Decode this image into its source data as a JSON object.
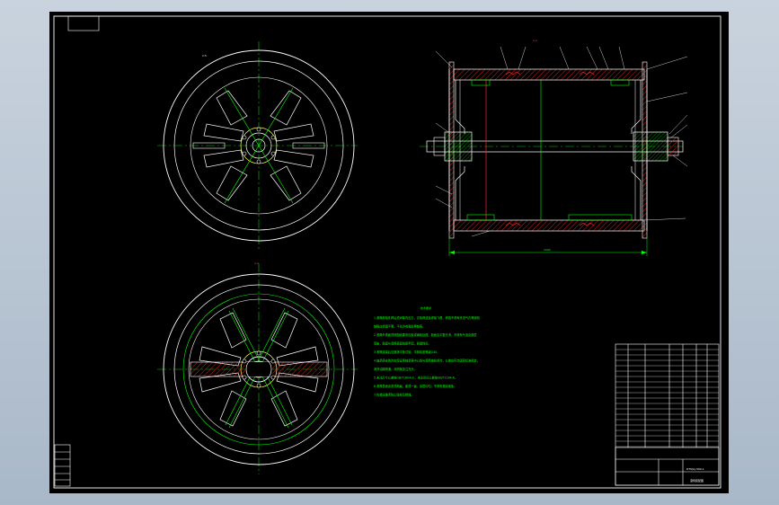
{
  "drawing": {
    "notes_title": "技术要求",
    "notes": [
      "1.滚筒焊接件焊后须消除内应力，去除焊渣及焊接飞溅，焊缝不得有夹渣气孔等缺陷",
      "  缺陷应修磨平整，不允许有裂纹等缺陷。",
      "2.滚筒外表面须按图纸要求包胶或铸胶处理，胶面应平整光滑，不得有气泡及脱层",
      "  现象，胶面与滚筒表面粘接牢固，耐磨性好。",
      "3.滚筒组装后应做静平衡试验，平衡精度等级G40。",
      "4.轴承座安装时应保证两轴承座中心线与滚筒轴线重合，公差应符合国家标准规定，",
      "  润滑油路畅通，润滑脂加注充分。",
      "5.未注尺寸公差按GB/T1804-m，未注形位公差按GB/T1184-K。",
      "6.滚筒表面涂底漆两遍，面漆一遍，涂层均匀，不得有漏涂现象。",
      "7.包装运输须防止碰撞及锈蚀。"
    ],
    "side_view_dim": "1000",
    "section_title": "A-A"
  },
  "title_block": {
    "drawing_name": "滚筒装配图",
    "drawing_code": "DTⅡ(A)-500-1"
  },
  "colors": {
    "frame": "#ffffff",
    "outline": "#ffffff",
    "centerline": "#00cc00",
    "dimension": "#00ff00",
    "hatch": "#ff2a2a",
    "weld": "#ffff00"
  }
}
